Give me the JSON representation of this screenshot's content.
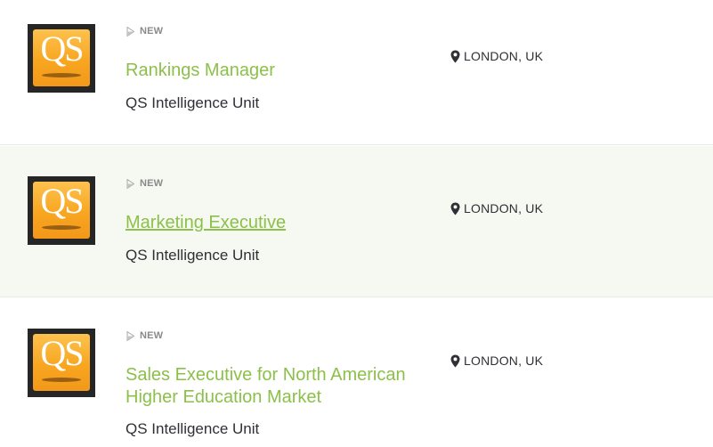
{
  "jobs": [
    {
      "badge": "NEW",
      "title": "Rankings Manager",
      "company": "QS Intelligence Unit",
      "location": "LONDON, UK",
      "logo_text": "QS"
    },
    {
      "badge": "NEW",
      "title": "Marketing Executive",
      "company": "QS Intelligence Unit",
      "location": "LONDON, UK",
      "logo_text": "QS"
    },
    {
      "badge": "NEW",
      "title": "Sales Executive for North American Higher Education Market",
      "company": "QS Intelligence Unit",
      "location": "LONDON, UK",
      "logo_text": "QS"
    }
  ],
  "colors": {
    "title_link": "#8cc04a",
    "hover_row": "#f6f9f1",
    "text": "#2f2f36",
    "badge": "#8a8a8a",
    "logo_orange": "#f8a620"
  },
  "icons": {
    "badge": "new-tag-icon",
    "location": "map-pin-icon"
  }
}
